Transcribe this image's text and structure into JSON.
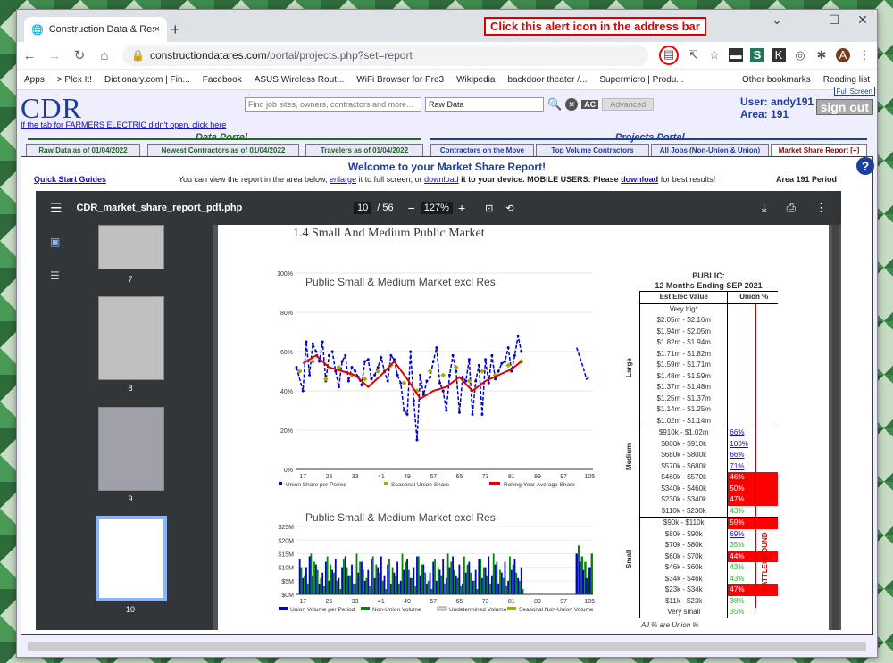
{
  "browser": {
    "tab_title": "Construction Data & Research, I",
    "url_host": "constructiondatares.com",
    "url_path": "/portal/projects.php?set=report",
    "callout": "Click this alert icon in the address bar",
    "bookmarks": [
      "Apps",
      "> Plex It!",
      "Dictionary.com | Fin...",
      "Facebook",
      "ASUS Wireless Rout...",
      "WiFi Browser for Pre3",
      "Wikipedia",
      "backdoor theater /...",
      "Supermicro | Produ...",
      "Other bookmarks",
      "Reading list"
    ]
  },
  "site": {
    "logo": "CDR",
    "tab_note": "If the tab for FARMERS ELECTRIC didn't open, click here",
    "search_placeholder": "Find job sites, owners, contractors and more...",
    "search_mode": "Raw Data",
    "ac": "AC",
    "advanced": "Advanced",
    "user": "User: andy191",
    "area": "Area: 191",
    "full_screen": "Full Screen",
    "sign_out": "sign out",
    "data_portal": "Data Portal",
    "projects_portal": "Projects Portal",
    "tabs": [
      "Raw Data as of 01/04/2022",
      "Newest Contractors as of 01/04/2022",
      "Travelers as of 01/04/2022",
      "Contractors on the Move",
      "Top Volume Contractors",
      "All Jobs (Non-Union & Union)",
      "Market Share Report  [+]"
    ],
    "welcome": "Welcome to your Market Share Report!",
    "desc_a": "You can view the report in the area below, ",
    "desc_enlarge": "enlarge",
    "desc_b": " it to full screen, or ",
    "desc_download": "download",
    "desc_c": " it to your device. MOBILE USERS: Please ",
    "desc_download2": "download",
    "desc_d": " for best results!",
    "quick_start": "Quick Start Guides",
    "area_label": "Area 191   Period"
  },
  "viewer": {
    "file": "CDR_market_share_report_pdf.php",
    "page": "10",
    "pages": "/ 56",
    "zoom": "127%",
    "thumb_labels": [
      "7",
      "8",
      "9",
      "10"
    ]
  },
  "pdf": {
    "section": "1.4   Small And Medium Public Market",
    "table_title1": "PUBLIC:",
    "table_title2": "12 Months Ending SEP 2021",
    "col_val": "Est Elec Value",
    "col_union": "Union %",
    "rows": [
      {
        "v": "Very big*",
        "u": ""
      },
      {
        "v": "$2.05m - $2.16m",
        "u": ""
      },
      {
        "v": "$1.94m - $2.05m",
        "u": ""
      },
      {
        "v": "$1.82m - $1.94m",
        "u": ""
      },
      {
        "v": "$1.71m - $1.82m",
        "u": ""
      },
      {
        "v": "$1.59m - $1.71m",
        "u": ""
      },
      {
        "v": "$1.48m - $1.59m",
        "u": ""
      },
      {
        "v": "$1.37m - $1.48m",
        "u": ""
      },
      {
        "v": "$1.25m - $1.37m",
        "u": ""
      },
      {
        "v": "$1.14m - $1.25m",
        "u": ""
      },
      {
        "v": "$1.02m - $1.14m",
        "u": ""
      },
      {
        "v": "$910k - $1.02m",
        "u": "66%",
        "c": "lnk"
      },
      {
        "v": "$800k - $910k",
        "u": "100%",
        "c": "lnk"
      },
      {
        "v": "$680k - $800k",
        "u": "66%",
        "c": "lnk"
      },
      {
        "v": "$570k - $680k",
        "u": "71%",
        "c": "lnk"
      },
      {
        "v": "$460k - $570k",
        "u": "46%",
        "c": "red"
      },
      {
        "v": "$340k - $460k",
        "u": "50%",
        "c": "red"
      },
      {
        "v": "$230k - $340k",
        "u": "47%",
        "c": "red"
      },
      {
        "v": "$110k - $230k",
        "u": "43%",
        "c": "grn"
      },
      {
        "v": "$90k - $110k",
        "u": "59%",
        "c": "red"
      },
      {
        "v": "$80k - $90k",
        "u": "69%",
        "c": "lnk"
      },
      {
        "v": "$70k - $80k",
        "u": "35%",
        "c": "grn"
      },
      {
        "v": "$60k - $70k",
        "u": "44%",
        "c": "red"
      },
      {
        "v": "$46k - $60k",
        "u": "43%",
        "c": "grn"
      },
      {
        "v": "$34k - $46k",
        "u": "43%",
        "c": "grn"
      },
      {
        "v": "$23k - $34k",
        "u": "47%",
        "c": "red"
      },
      {
        "v": "$11k - $23k",
        "u": "38%",
        "c": "grn"
      },
      {
        "v": "Very small",
        "u": "35%",
        "c": "grn"
      }
    ],
    "grp_large": "Large",
    "grp_medium": "Medium",
    "grp_small": "Small",
    "battleground": "BATTLEGROUND",
    "footnote": "All % are Union %"
  },
  "chart_data": [
    {
      "type": "line",
      "title": "Public Small & Medium Market excl Res",
      "xlabel": "",
      "ylabel": "",
      "x_ticks": [
        "17",
        "25",
        "33",
        "41",
        "49",
        "57",
        "65",
        "73",
        "81",
        "89",
        "97",
        "105"
      ],
      "y_ticks": [
        "0%",
        "20%",
        "40%",
        "60%",
        "80%",
        "100%"
      ],
      "ylim": [
        0,
        100
      ],
      "xlim": [
        15,
        106
      ],
      "series": [
        {
          "name": "Union Share per Period",
          "color": "#0000cc",
          "x": [
            15,
            17,
            18,
            19,
            20,
            21,
            22,
            23,
            24,
            25,
            26,
            27,
            28,
            29,
            30,
            31,
            32,
            33,
            34,
            35,
            36,
            37,
            38,
            39,
            40,
            41,
            42,
            43,
            44,
            45,
            46,
            47,
            48,
            49,
            50,
            51,
            52,
            53,
            54,
            55,
            56,
            57,
            58,
            59,
            60,
            61,
            62,
            63,
            64,
            65,
            66,
            67,
            68,
            69,
            70,
            71,
            72,
            73,
            74,
            75,
            76,
            77,
            78,
            79,
            80,
            81,
            82,
            83,
            84
          ],
          "y": [
            52,
            40,
            65,
            48,
            64,
            60,
            55,
            65,
            45,
            58,
            60,
            50,
            42,
            55,
            58,
            45,
            52,
            50,
            47,
            43,
            55,
            56,
            46,
            48,
            52,
            57,
            50,
            45,
            58,
            56,
            48,
            44,
            30,
            28,
            60,
            35,
            15,
            48,
            38,
            45,
            47,
            55,
            62,
            44,
            40,
            30,
            48,
            58,
            50,
            29,
            47,
            45,
            56,
            28,
            45,
            53,
            28,
            56,
            44,
            58,
            46,
            50,
            54,
            55,
            62,
            50,
            58,
            68,
            60
          ]
        },
        {
          "name": "Seasonal Union Share",
          "color": "#aaaa00",
          "x": [
            16,
            20,
            24,
            28,
            32,
            36,
            40,
            44,
            48,
            52,
            56,
            60,
            64,
            68,
            72,
            76,
            80,
            84
          ],
          "y": [
            50,
            55,
            46,
            52,
            48,
            46,
            50,
            53,
            44,
            40,
            50,
            48,
            52,
            45,
            50,
            48,
            53,
            55
          ]
        },
        {
          "name": "Rolling-Year Average Share",
          "color": "#e00000",
          "x": [
            17,
            21,
            25,
            29,
            33,
            37,
            41,
            45,
            49,
            53,
            57,
            61,
            65,
            69,
            73,
            77,
            81,
            84
          ],
          "y": [
            54,
            58,
            52,
            50,
            48,
            42,
            48,
            55,
            46,
            36,
            40,
            42,
            47,
            40,
            45,
            48,
            51,
            55
          ]
        }
      ]
    },
    {
      "type": "bar",
      "title": "Public Small & Medium Market excl Res",
      "xlabel": "",
      "ylabel": "",
      "x_ticks": [
        "17",
        "25",
        "33",
        "41",
        "49",
        "57",
        "65",
        "73",
        "81",
        "89",
        "97",
        "105"
      ],
      "y_ticks": [
        "$0M",
        "$5M",
        "$10M",
        "$15M",
        "$20M",
        "$25M"
      ],
      "ylim": [
        0,
        27
      ],
      "series": [
        {
          "name": "Union Volume per Period",
          "color": "#0000cc"
        },
        {
          "name": "Non-Union Volume",
          "color": "#008800"
        },
        {
          "name": "Undetermined Volume",
          "color": "#dddddd"
        },
        {
          "name": "Seasonal Non-Union Volume",
          "color": "#aaaa00"
        }
      ]
    }
  ]
}
